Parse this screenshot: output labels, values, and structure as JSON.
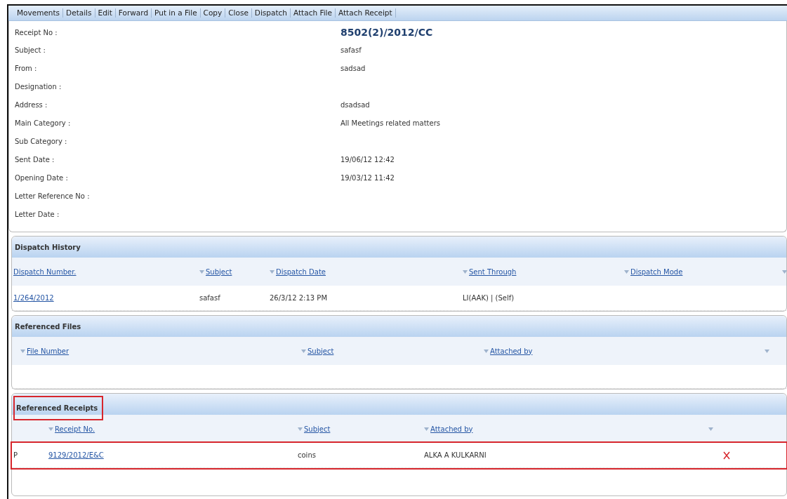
{
  "toolbar": [
    {
      "label": "Movements"
    },
    {
      "label": "Details"
    },
    {
      "label": "Edit"
    },
    {
      "label": "Forward"
    },
    {
      "label": "Put in a File"
    },
    {
      "label": "Copy"
    },
    {
      "label": "Close"
    },
    {
      "label": "Dispatch"
    },
    {
      "label": "Attach File"
    },
    {
      "label": "Attach Receipt"
    }
  ],
  "details": [
    {
      "label": "Receipt No :",
      "value": "8502(2)/2012/CC",
      "kind": "heading"
    },
    {
      "label": "Subject :",
      "value": "safasf",
      "kind": "plain"
    },
    {
      "label": "From :",
      "value": "sadsad",
      "kind": "plain"
    },
    {
      "label": "Designation :",
      "kind": "plain"
    },
    {
      "label": "Address :",
      "value": "dsadsad",
      "kind": "plain"
    },
    {
      "label": "Main Category :",
      "value": "All Meetings related matters",
      "kind": "plain"
    },
    {
      "label": "Sub Category :",
      "kind": "plain"
    },
    {
      "label": "Sent Date :",
      "value": "19/06/12 12:42",
      "kind": "plain"
    },
    {
      "label": "Opening Date :",
      "value": "19/03/12 11:42",
      "kind": "plain"
    },
    {
      "label": "Letter Reference No :",
      "kind": "plain"
    },
    {
      "label": "Letter Date :",
      "kind": "plain"
    }
  ],
  "sections": [
    {
      "title": "Dispatch History",
      "highlighted": false,
      "columns": [
        {
          "label": "Dispatch Number.",
          "sort_arrow": false
        },
        {
          "label": "Subject",
          "sort_arrow": true
        },
        {
          "label": "Dispatch Date",
          "sort_arrow": true
        },
        {
          "label": "Sent Through",
          "sort_arrow": true
        },
        {
          "label": "Dispatch Mode",
          "sort_arrow": true
        },
        {
          "sort_arrow": true
        }
      ],
      "rows": [
        {
          "highlighted": false,
          "deletable": false,
          "cells": [
            {
              "text": "1/264/2012",
              "link": true
            },
            {
              "text": "safasf",
              "link": false
            },
            {
              "text": "26/3/12 2:13 PM",
              "link": false
            },
            {
              "text": "LI(AAK) | (Self)",
              "link": false
            }
          ]
        }
      ]
    },
    {
      "title": "Referenced Files",
      "highlighted": false,
      "columns": [
        {
          "label": "File Number",
          "sort_arrow": true
        },
        {
          "label": "Subject",
          "sort_arrow": true
        },
        {
          "label": "Attached by",
          "sort_arrow": true
        },
        {
          "sort_arrow": true
        }
      ]
    },
    {
      "title": "Referenced Receipts",
      "highlighted": true,
      "columns": [
        {
          "sort_arrow": false
        },
        {
          "label": "Receipt No.",
          "sort_arrow": true
        },
        {
          "label": "Subject",
          "sort_arrow": true
        },
        {
          "label": "Attached by",
          "sort_arrow": true
        },
        {
          "sort_arrow": true
        }
      ],
      "rows": [
        {
          "highlighted": true,
          "deletable": true,
          "cells": [
            {
              "text": "P",
              "link": false
            },
            {
              "text": "9129/2012/E&C",
              "link": true
            },
            {
              "text": "coins",
              "link": false
            },
            {
              "text": "ALKA A KULKARNI",
              "link": false
            }
          ]
        }
      ]
    }
  ]
}
